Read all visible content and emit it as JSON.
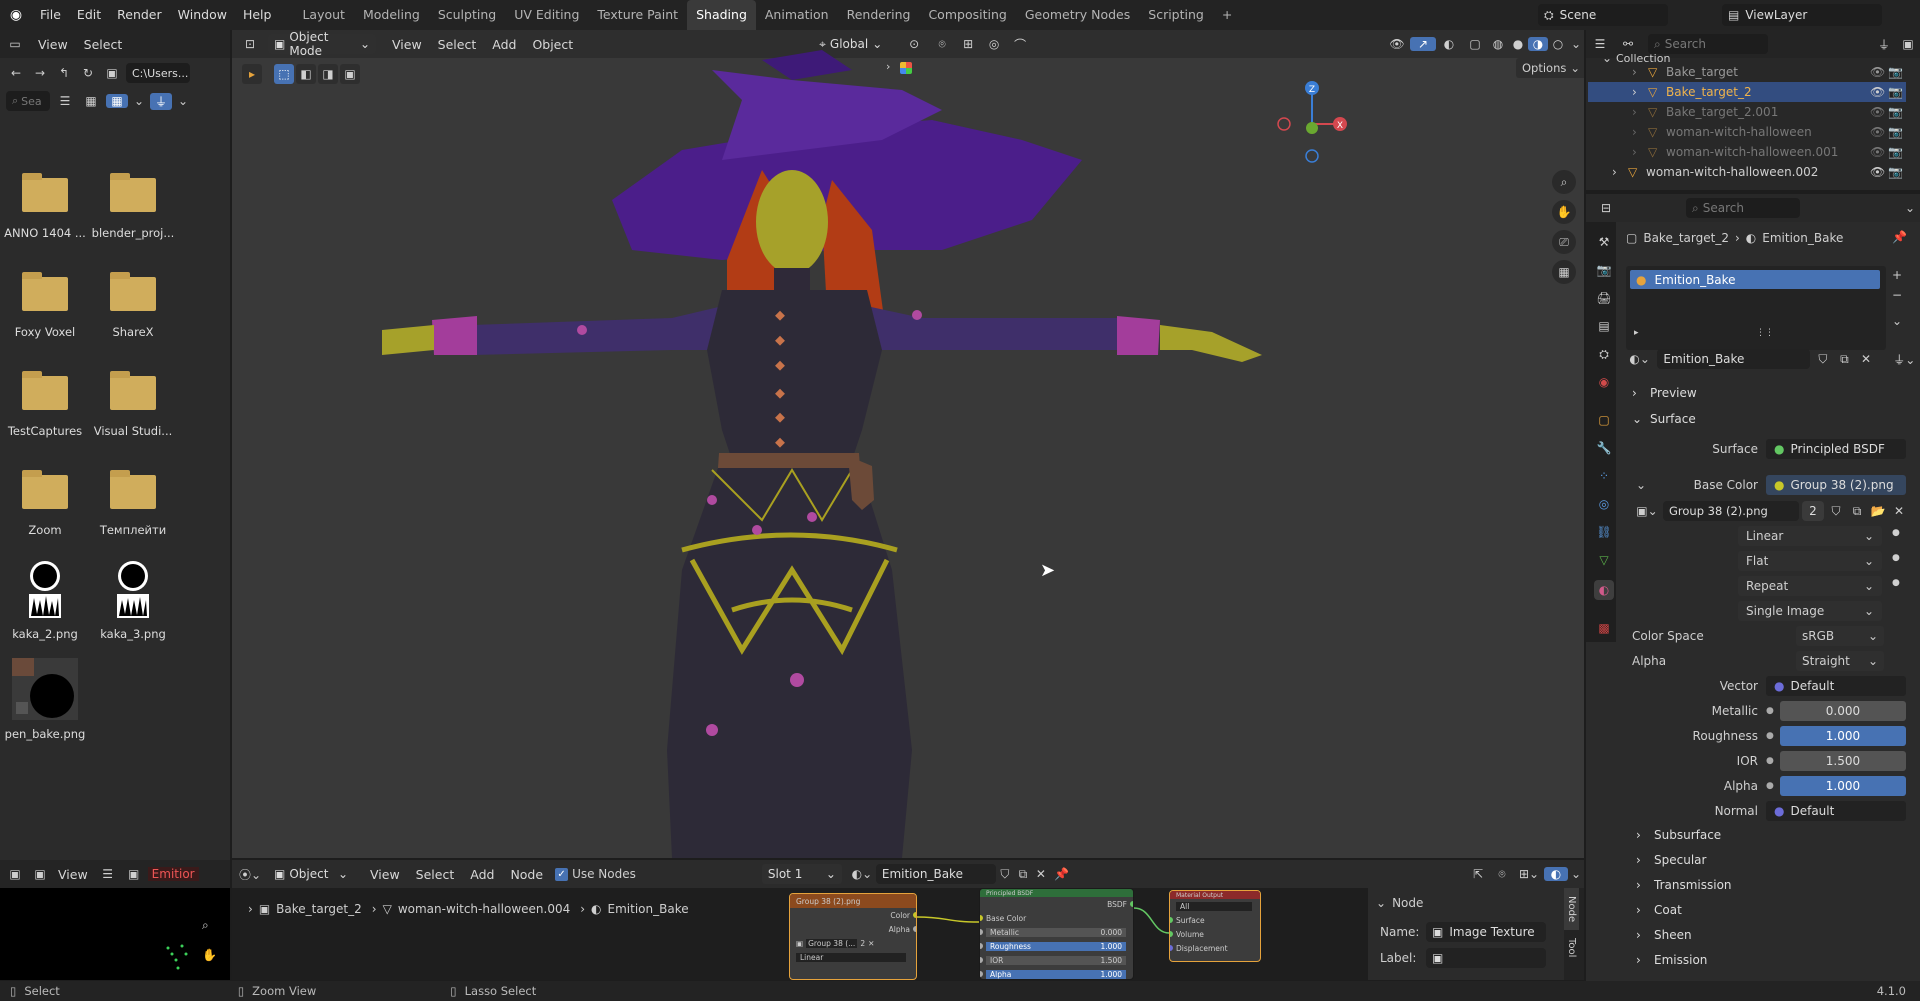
{
  "topbar": {
    "menus": [
      "File",
      "Edit",
      "Render",
      "Window",
      "Help"
    ],
    "workspaces": [
      "Layout",
      "Modeling",
      "Sculpting",
      "UV Editing",
      "Texture Paint",
      "Shading",
      "Animation",
      "Rendering",
      "Compositing",
      "Geometry Nodes",
      "Scripting"
    ],
    "active_workspace": "Shading",
    "add_tab": "+",
    "scene": "Scene",
    "view_layer": "ViewLayer"
  },
  "file_browser": {
    "menus": [
      "View",
      "Select"
    ],
    "path": "C:\\Users...",
    "search_placeholder": "Sea",
    "items": [
      {
        "name": "ANNO 1404 ...",
        "type": "folder"
      },
      {
        "name": "blender_proj...",
        "type": "folder"
      },
      {
        "name": "Foxy Voxel",
        "type": "folder"
      },
      {
        "name": "ShareX",
        "type": "folder"
      },
      {
        "name": "TestCaptures",
        "type": "folder"
      },
      {
        "name": "Visual Studi...",
        "type": "folder"
      },
      {
        "name": "Zoom",
        "type": "folder"
      },
      {
        "name": "Темплейти",
        "type": "folder"
      },
      {
        "name": "kaka_2.png",
        "type": "image"
      },
      {
        "name": "kaka_3.png",
        "type": "image"
      },
      {
        "name": "pen_bake.png",
        "type": "image"
      }
    ]
  },
  "viewport": {
    "mode": "Object Mode",
    "menus": [
      "View",
      "Select",
      "Add",
      "Object"
    ],
    "orientation": "Global",
    "options": "Options",
    "gizmo_axes": {
      "x": "X",
      "y": "Y",
      "z": "Z"
    }
  },
  "outliner": {
    "search_placeholder": "Search",
    "collection": "Collection",
    "items": [
      {
        "name": "Bake_target",
        "selected": false,
        "dim": false
      },
      {
        "name": "Bake_target_2",
        "selected": true,
        "dim": false
      },
      {
        "name": "Bake_target_2.001",
        "selected": false,
        "dim": true
      },
      {
        "name": "woman-witch-halloween",
        "selected": false,
        "dim": true
      },
      {
        "name": "woman-witch-halloween.001",
        "selected": false,
        "dim": true
      },
      {
        "name": "woman-witch-halloween.002",
        "selected": false,
        "dim": false
      }
    ]
  },
  "properties": {
    "search_placeholder": "Search",
    "breadcrumb_object": "Bake_target_2",
    "breadcrumb_material": "Emition_Bake",
    "slot_name": "Emition_Bake",
    "material_name": "Emition_Bake",
    "sections": {
      "preview": "Preview",
      "surface": "Surface"
    },
    "surface_label": "Surface",
    "surface_value": "Principled BSDF",
    "base_color_label": "Base Color",
    "base_color_value": "Group 38 (2).png",
    "image_name": "Group 38 (2).png",
    "image_users": "2",
    "interpolation": "Linear",
    "projection": "Flat",
    "extension": "Repeat",
    "source": "Single Image",
    "color_space_label": "Color Space",
    "color_space": "sRGB",
    "alpha_mode_label": "Alpha",
    "alpha_mode": "Straight",
    "vector_label": "Vector",
    "vector_value": "Default",
    "metallic_label": "Metallic",
    "metallic": "0.000",
    "roughness_label": "Roughness",
    "roughness": "1.000",
    "ior_label": "IOR",
    "ior": "1.500",
    "alpha_label": "Alpha",
    "alpha": "1.000",
    "normal_label": "Normal",
    "normal_value": "Default",
    "collapsed": [
      "Subsurface",
      "Specular",
      "Transmission",
      "Coat",
      "Sheen",
      "Emission"
    ]
  },
  "node_editor": {
    "object_label": "Object",
    "menus": [
      "View",
      "Select",
      "Add",
      "Node"
    ],
    "use_nodes": "Use Nodes",
    "slot": "Slot 1",
    "material": "Emition_Bake",
    "breadcrumb": [
      "Bake_target_2",
      "woman-witch-halloween.004",
      "Emition_Bake"
    ],
    "image_node": {
      "title": "Group 38 (2).png",
      "color": "Color",
      "alpha": "Alpha",
      "img": "Group 38 (...",
      "users": "2",
      "interp": "Linear"
    },
    "bsdf_node": {
      "title": "Principled BSDF",
      "out": "BSDF",
      "base_color": "Base Color",
      "metallic": "Metallic",
      "metallic_val": "0.000",
      "roughness": "Roughness",
      "roughness_val": "1.000",
      "ior": "IOR",
      "ior_val": "1.500",
      "alpha": "Alpha",
      "alpha_val": "1.000"
    },
    "output_node": {
      "title": "Material Output",
      "target": "All",
      "surface": "Surface",
      "volume": "Volume",
      "displacement": "Displacement"
    },
    "sidepanel": {
      "section": "Node",
      "name_label": "Name:",
      "name_value": "Image Texture",
      "label_label": "Label:",
      "tab_node": "Node",
      "tab_tool": "Tool"
    }
  },
  "image_editor": {
    "view": "View",
    "name": "Emitior"
  },
  "statusbar": {
    "select": "Select",
    "zoom": "Zoom View",
    "lasso": "Lasso Select",
    "version": "4.1.0"
  }
}
